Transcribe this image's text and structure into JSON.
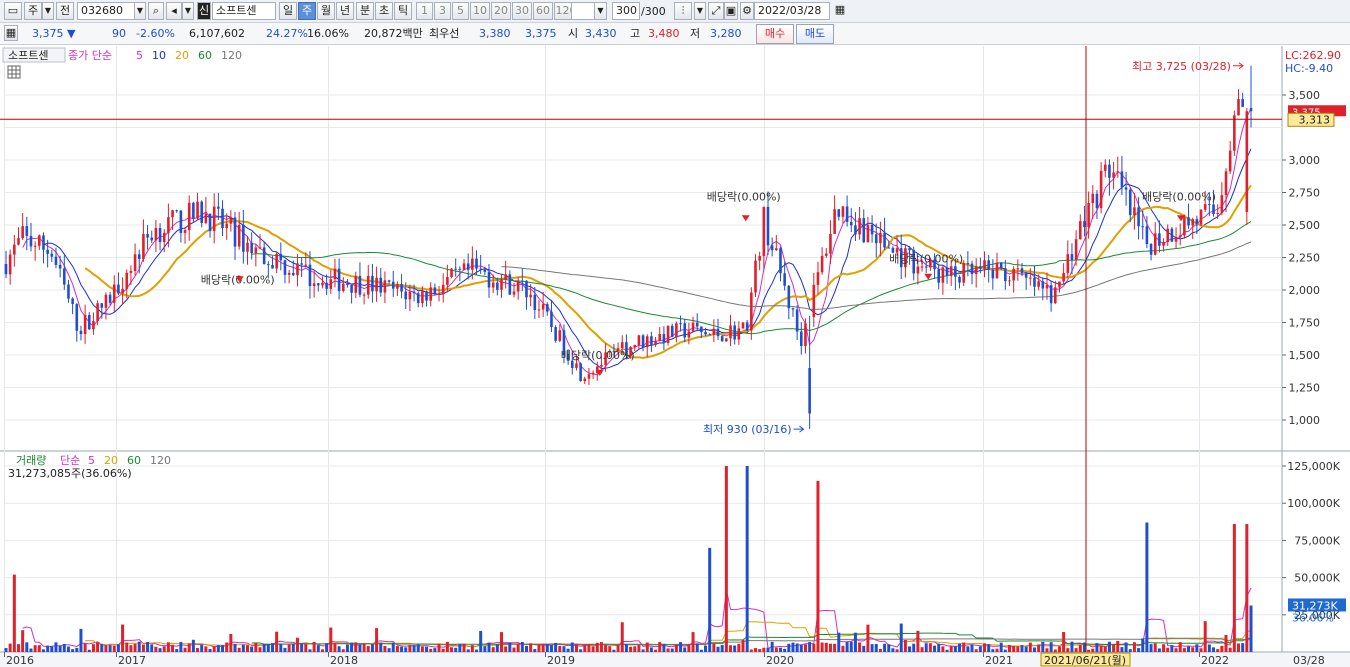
{
  "toolbar": {
    "market_label": "주",
    "prev_label": "전",
    "code": "032680",
    "stock_badge": "신",
    "stock_name": "소프트센",
    "periods": [
      "일",
      "주",
      "월",
      "년",
      "분",
      "초",
      "틱"
    ],
    "selected_period": "주",
    "intervals": [
      "1",
      "3",
      "5",
      "10",
      "20",
      "30",
      "60",
      "120"
    ],
    "count": "300",
    "count_total": "/300",
    "date": "2022/03/28"
  },
  "quote": {
    "price": "3,375",
    "change": "90",
    "change_pct": "-2.60%",
    "volume": "6,107,602",
    "turnover_pct": "24.27%",
    "ratio_pct": "16.06%",
    "amount": "20,872백만",
    "best_ask_label": "최우선",
    "best_ask": "3,380",
    "best_bid": "3,375",
    "open_label": "시",
    "open": "3,430",
    "high_label": "고",
    "high": "3,480",
    "low_label": "저",
    "low": "3,280",
    "buy_label": "매수",
    "sell_label": "매도"
  },
  "price_panel": {
    "name": "소프트센",
    "ma_title": "종가 단순",
    "ma_periods": [
      "5",
      "10",
      "20",
      "60",
      "120"
    ],
    "ma_colors": [
      "#d030c0",
      "#1a2fd0",
      "#e0a000",
      "#1a8a30",
      "#777777"
    ],
    "lc": "LC:262.90",
    "hc": "HC:-9.40",
    "last_price_tag": "3,375",
    "cross_price_tag": "3,313",
    "high_note": "최고 3,725 (03/28)",
    "low_note": "최저 930 (03/16)",
    "dividend_label": "배당락(0.00%)"
  },
  "volume_panel": {
    "title": "거래량",
    "ma_title": "단순",
    "ma_periods": [
      "5",
      "20",
      "60",
      "120"
    ],
    "ma_colors": [
      "#d030c0",
      "#e0a000",
      "#1a8a30",
      "#777777"
    ],
    "current": "31,273,085주(36.06%)",
    "last_tag": "31,273K",
    "pct_tag": "36.06%"
  },
  "x_axis": {
    "years": [
      "2016",
      "2017",
      "2018",
      "2019",
      "2020",
      "2021",
      "2022"
    ],
    "cursor_label": "2021/06/21(월)",
    "right_label": "03/28"
  },
  "colors": {
    "up": "#e0202a",
    "down": "#1f4fd0",
    "cursor": "#c00000"
  },
  "chart_data": [
    {
      "type": "candlestick",
      "title": "소프트센",
      "x_range": [
        "2016-01",
        "2022-03-28"
      ],
      "y_ticks": [
        1000,
        1250,
        1500,
        1750,
        2000,
        2250,
        2500,
        2750,
        3000,
        3250,
        3500
      ],
      "ylim": [
        900,
        3800
      ],
      "scale": "linear",
      "grid": true,
      "close_series": {
        "name": "종가",
        "x": [
          "2016-01",
          "2016-03",
          "2016-06",
          "2016-09",
          "2016-12",
          "2017-03",
          "2017-06",
          "2017-09",
          "2017-12",
          "2018-03",
          "2018-06",
          "2018-09",
          "2018-12",
          "2019-01",
          "2019-03",
          "2019-06",
          "2019-09",
          "2019-10",
          "2019-12",
          "2020-01",
          "2020-03",
          "2020-05",
          "2020-08",
          "2020-11",
          "2021-02",
          "2021-05",
          "2021-06",
          "2021-08",
          "2021-10",
          "2021-12",
          "2022-02",
          "2022-03"
        ],
        "values": [
          2200,
          2400,
          2300,
          1700,
          1900,
          2450,
          2600,
          2300,
          2100,
          2050,
          1950,
          2150,
          2000,
          1800,
          1350,
          1600,
          1700,
          1650,
          1700,
          2550,
          1600,
          2650,
          2300,
          2100,
          2150,
          1950,
          2350,
          2950,
          2350,
          2500,
          2600,
          3375
        ]
      },
      "annotations": [
        {
          "text": "최고 3,725 (03/28)",
          "x": "2022-03-28",
          "y": 3725
        },
        {
          "text": "최저 930 (03/16)",
          "x": "2020-03-16",
          "y": 930
        }
      ]
    },
    {
      "type": "bar",
      "title": "거래량",
      "y_ticks": [
        "25,000K",
        "50,000K",
        "75,000K",
        "100,000K",
        "125,000K"
      ],
      "ylim": [
        0,
        130000
      ],
      "notable_spikes_k": [
        {
          "x": "2016-02",
          "value": 52000
        },
        {
          "x": "2019-10",
          "value": 70000
        },
        {
          "x": "2019-11",
          "value": 125000
        },
        {
          "x": "2019-12",
          "value": 125000
        },
        {
          "x": "2020-04",
          "value": 115000
        },
        {
          "x": "2021-10",
          "value": 87000
        },
        {
          "x": "2022-03",
          "value": 86000
        }
      ],
      "last_value_k": 31273
    }
  ]
}
